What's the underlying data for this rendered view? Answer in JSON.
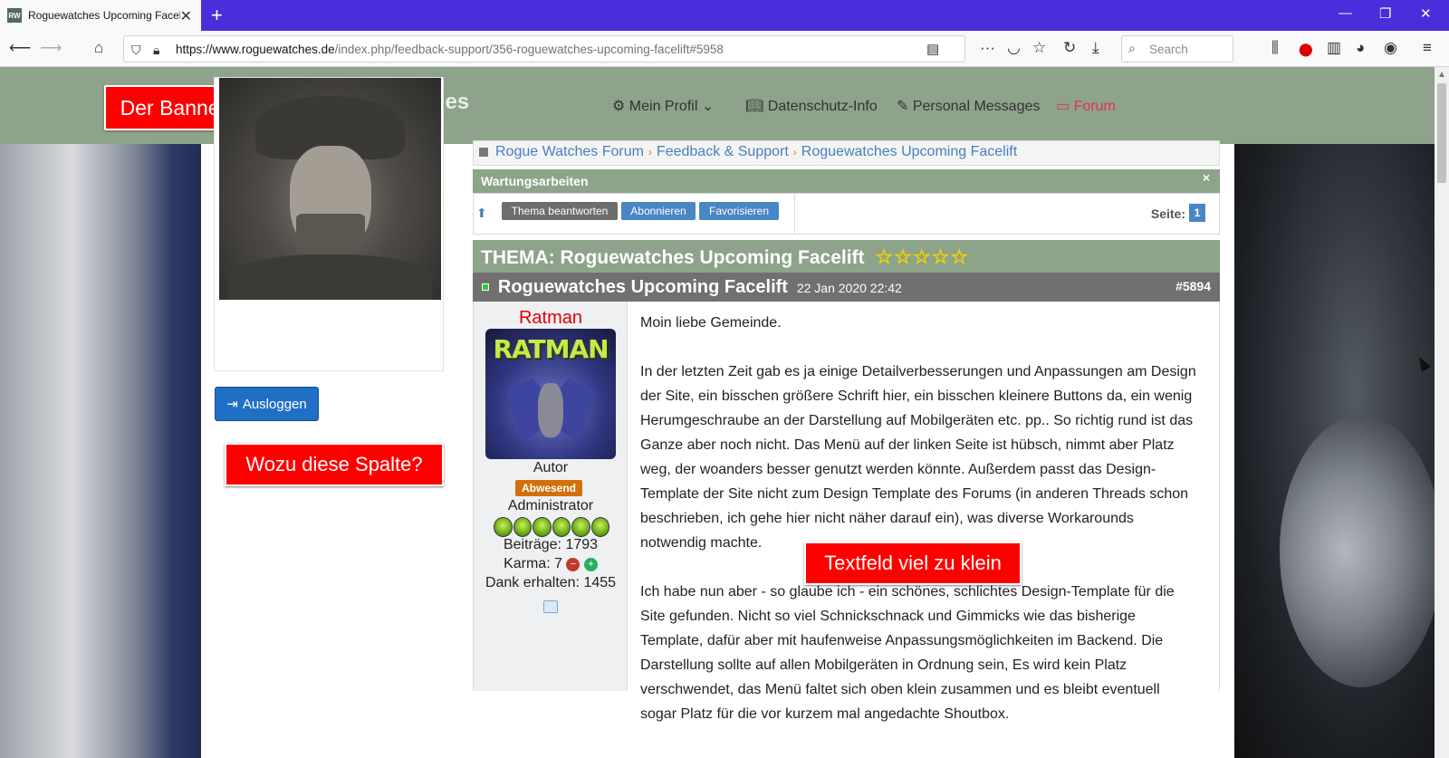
{
  "browser": {
    "tab_title": "Roguewatches Upcoming Facelift",
    "favicon_text": "RW",
    "new_tab_symbol": "+",
    "url_domain": "https://www.roguewatches.de",
    "url_path": "/index.php/feedback-support/356-roguewatches-upcoming-facelift#5958",
    "search_placeholder": "Search"
  },
  "header": {
    "banner_button": "Der Banner stört",
    "site_title": "Rogue Watches",
    "nav": [
      {
        "label": "Mein Profil"
      },
      {
        "label": "Datenschutz-Info"
      },
      {
        "label": "Personal Messages"
      },
      {
        "label": "Forum"
      }
    ]
  },
  "sidebar": {
    "logout_button": "Ausloggen",
    "wozu_button": "Wozu diese Spalte?"
  },
  "breadcrumb": [
    "Rogue Watches Forum",
    "Feedback & Support",
    "Roguewatches Upcoming Facelift"
  ],
  "maintenance": {
    "title": "Wartungsarbeiten",
    "close": "×"
  },
  "actions": {
    "reply": "Thema beantworten",
    "subscribe": "Abonnieren",
    "favorite": "Favorisieren",
    "page_label": "Seite:",
    "page_number": "1"
  },
  "thread": {
    "title": "THEMA: Roguewatches Upcoming Facelift",
    "rating_stars": 5
  },
  "post": {
    "title": "Roguewatches Upcoming Facelift",
    "date": "22 Jan 2020 22:42",
    "id": "#5894",
    "author": {
      "name": "Ratman",
      "avatar_text": "RATMAN",
      "rank": "Autor",
      "status": "Abwesend",
      "role": "Administrator",
      "rank_icons": 6,
      "posts": "Beiträge: 1793",
      "karma": "Karma: 7",
      "thanks": "Dank erhalten: 1455"
    },
    "paragraphs": [
      "Moin liebe Gemeinde.",
      "In der letzten Zeit gab es ja einige Detailverbesserungen und Anpassungen am Design der Site, ein bisschen größere Schrift hier, ein bisschen kleinere Buttons da, ein wenig Herumgeschraube an der Darstellung auf Mobilgeräten etc. pp.. So richtig rund ist das Ganze aber noch nicht. Das Menü auf der linken Seite ist hübsch, nimmt aber Platz weg, der woanders besser genutzt werden könnte. Außerdem passt das Design-Template der Site nicht zum Design Template des Forums (in anderen Threads schon beschrieben, ich gehe hier nicht näher darauf ein), was diverse Workarounds notwendig machte.",
      "Ich habe nun aber - so glaube ich - ein schönes, schlichtes Design-Template für die Site gefunden. Nicht so viel Schnickschnack und Gimmicks wie das bisherige Template, dafür aber mit haufenweise Anpassungsmöglichkeiten im Backend. Die Darstellung sollte auf allen Mobilgeräten in Ordnung sein, Es wird kein Platz verschwendet, das Menü faltet sich oben klein zusammen und es bleibt eventuell sogar Platz für die vor kurzem mal angedachte Shoutbox."
    ]
  },
  "annotations": {
    "textfeld_button": "Textfeld viel zu klein"
  },
  "colors": {
    "header_green": "#8da38a",
    "annotation_red": "#ff0000",
    "link_blue": "#4a7fbf",
    "tabbar_purple": "#4a2ddb"
  }
}
